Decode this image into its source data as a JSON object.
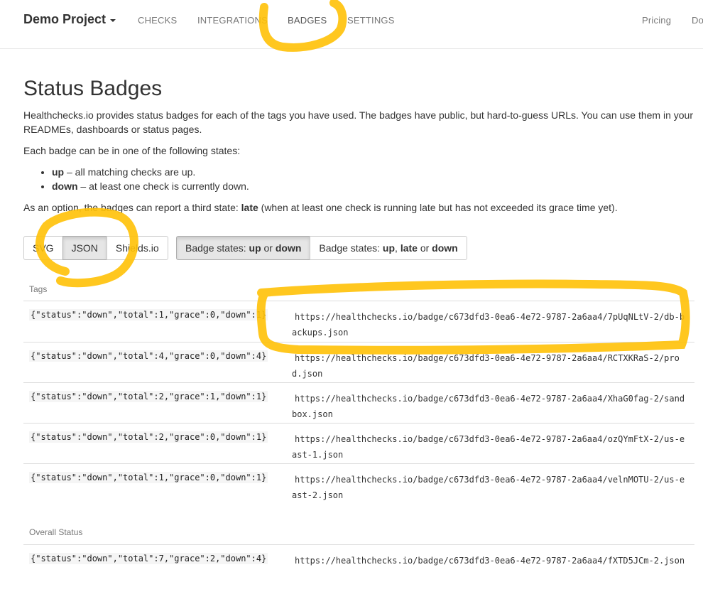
{
  "navbar": {
    "brand": "Demo Project",
    "links": [
      "CHECKS",
      "INTEGRATIONS",
      "BADGES",
      "SETTINGS"
    ],
    "right_links": [
      "Pricing",
      "Do"
    ]
  },
  "page": {
    "title": "Status Badges",
    "intro_line1": "Healthchecks.io provides status badges for each of the tags you have used. The badges have public, but hard-to-guess URLs. You can use them in your",
    "intro_line2": "READMEs, dashboards or status pages.",
    "states_intro": "Each badge can be in one of the following states:",
    "states": [
      {
        "name": "up",
        "desc": " – all matching checks are up."
      },
      {
        "name": "down",
        "desc": " – at least one check is currently down."
      }
    ],
    "option_text_before": "As an option, the badges can report a third state: ",
    "option_bold": "late",
    "option_text_after": " (when at least one check is running late but has not exceeded its grace time yet)."
  },
  "format_buttons": [
    "SVG",
    "JSON",
    "Shields.io"
  ],
  "format_selected": "JSON",
  "state_buttons": {
    "b1_prefix": "Badge states: ",
    "b1_up": "up",
    "b1_or": " or ",
    "b1_down": "down",
    "b2_prefix": "Badge states: ",
    "b2_up": "up",
    "b2_comma": ", ",
    "b2_late": "late",
    "b2_or": " or ",
    "b2_down": "down"
  },
  "tags_label": "Tags",
  "tags": [
    {
      "status": "{\"status\":\"down\",\"total\":1,\"grace\":0,\"down\":1}",
      "url": "https://healthchecks.io/badge/c673dfd3-0ea6-4e72-9787-2a6aa4/7pUqNLtV-2/db-backups.json"
    },
    {
      "status": "{\"status\":\"down\",\"total\":4,\"grace\":0,\"down\":4}",
      "url": "https://healthchecks.io/badge/c673dfd3-0ea6-4e72-9787-2a6aa4/RCTXKRaS-2/prod.json"
    },
    {
      "status": "{\"status\":\"down\",\"total\":2,\"grace\":1,\"down\":1}",
      "url": "https://healthchecks.io/badge/c673dfd3-0ea6-4e72-9787-2a6aa4/XhaG0fag-2/sandbox.json"
    },
    {
      "status": "{\"status\":\"down\",\"total\":2,\"grace\":0,\"down\":1}",
      "url": "https://healthchecks.io/badge/c673dfd3-0ea6-4e72-9787-2a6aa4/ozQYmFtX-2/us-east-1.json"
    },
    {
      "status": "{\"status\":\"down\",\"total\":1,\"grace\":0,\"down\":1}",
      "url": "https://healthchecks.io/badge/c673dfd3-0ea6-4e72-9787-2a6aa4/velnMOTU-2/us-east-2.json"
    }
  ],
  "overall_label": "Overall Status",
  "overall": {
    "status": "{\"status\":\"down\",\"total\":7,\"grace\":2,\"down\":4}",
    "url": "https://healthchecks.io/badge/c673dfd3-0ea6-4e72-9787-2a6aa4/fXTD5JCm-2.json"
  },
  "colors": {
    "highlighter": "#ffc107",
    "active_button": "#e6e6e6",
    "code_bg": "#f5f5f5"
  }
}
